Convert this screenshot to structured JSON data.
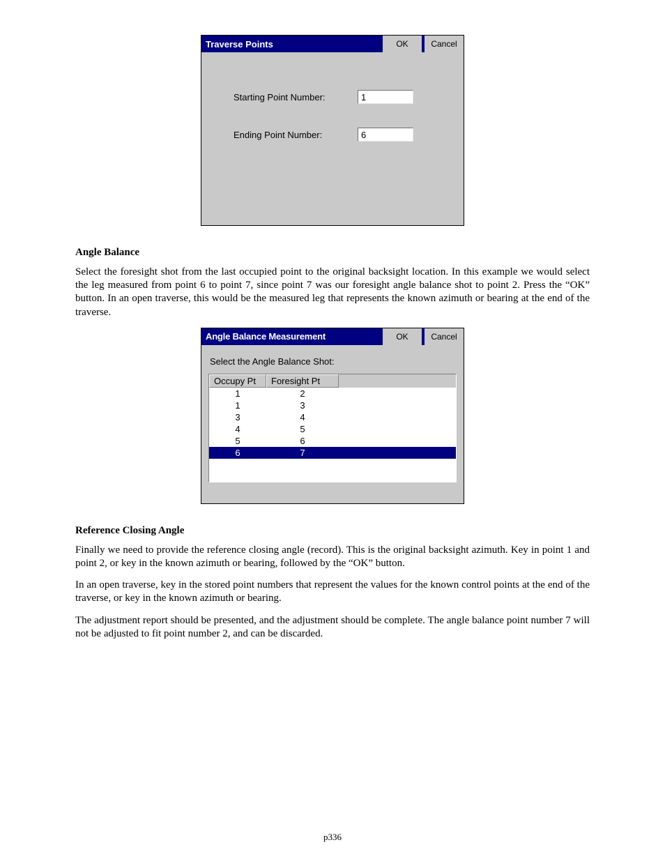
{
  "dialog1": {
    "title": "Traverse Points",
    "ok_label": "OK",
    "cancel_label": "Cancel",
    "start_label": "Starting Point Number:",
    "start_value": "1",
    "end_label": "Ending Point Number:",
    "end_value": "6"
  },
  "section1": {
    "heading": "Angle Balance",
    "para": "Select the foresight shot from the last occupied point to the original backsight location. In this example we would select the leg measured from point 6 to point 7, since point 7 was our foresight angle balance shot to point 2. Press the “OK” button. In an open traverse, this would be the measured leg that represents the known azimuth or bearing at the end of the traverse."
  },
  "dialog2": {
    "title": "Angle Balance Measurement",
    "ok_label": "OK",
    "cancel_label": "Cancel",
    "instruction": "Select the Angle Balance Shot:",
    "col_a": "Occupy Pt",
    "col_b": "Foresight Pt",
    "rows": [
      {
        "a": "1",
        "b": "2",
        "sel": false
      },
      {
        "a": "1",
        "b": "3",
        "sel": false
      },
      {
        "a": "3",
        "b": "4",
        "sel": false
      },
      {
        "a": "4",
        "b": "5",
        "sel": false
      },
      {
        "a": "5",
        "b": "6",
        "sel": false
      },
      {
        "a": "6",
        "b": "7",
        "sel": true
      }
    ]
  },
  "section2": {
    "heading": "Reference Closing Angle",
    "para1": "Finally we need to provide the reference closing angle (record). This is the original backsight azimuth. Key in point 1 and point 2, or key in the known azimuth or bearing, followed by the “OK” button.",
    "para2": "In an open traverse, key in the stored point numbers that represent the values for the known control points at the end of the traverse, or key in the known azimuth or bearing.",
    "para3": "The adjustment report should be presented, and the adjustment should be complete. The angle balance point number 7 will not be adjusted to fit point number 2, and can be discarded."
  },
  "page_number": "p336"
}
